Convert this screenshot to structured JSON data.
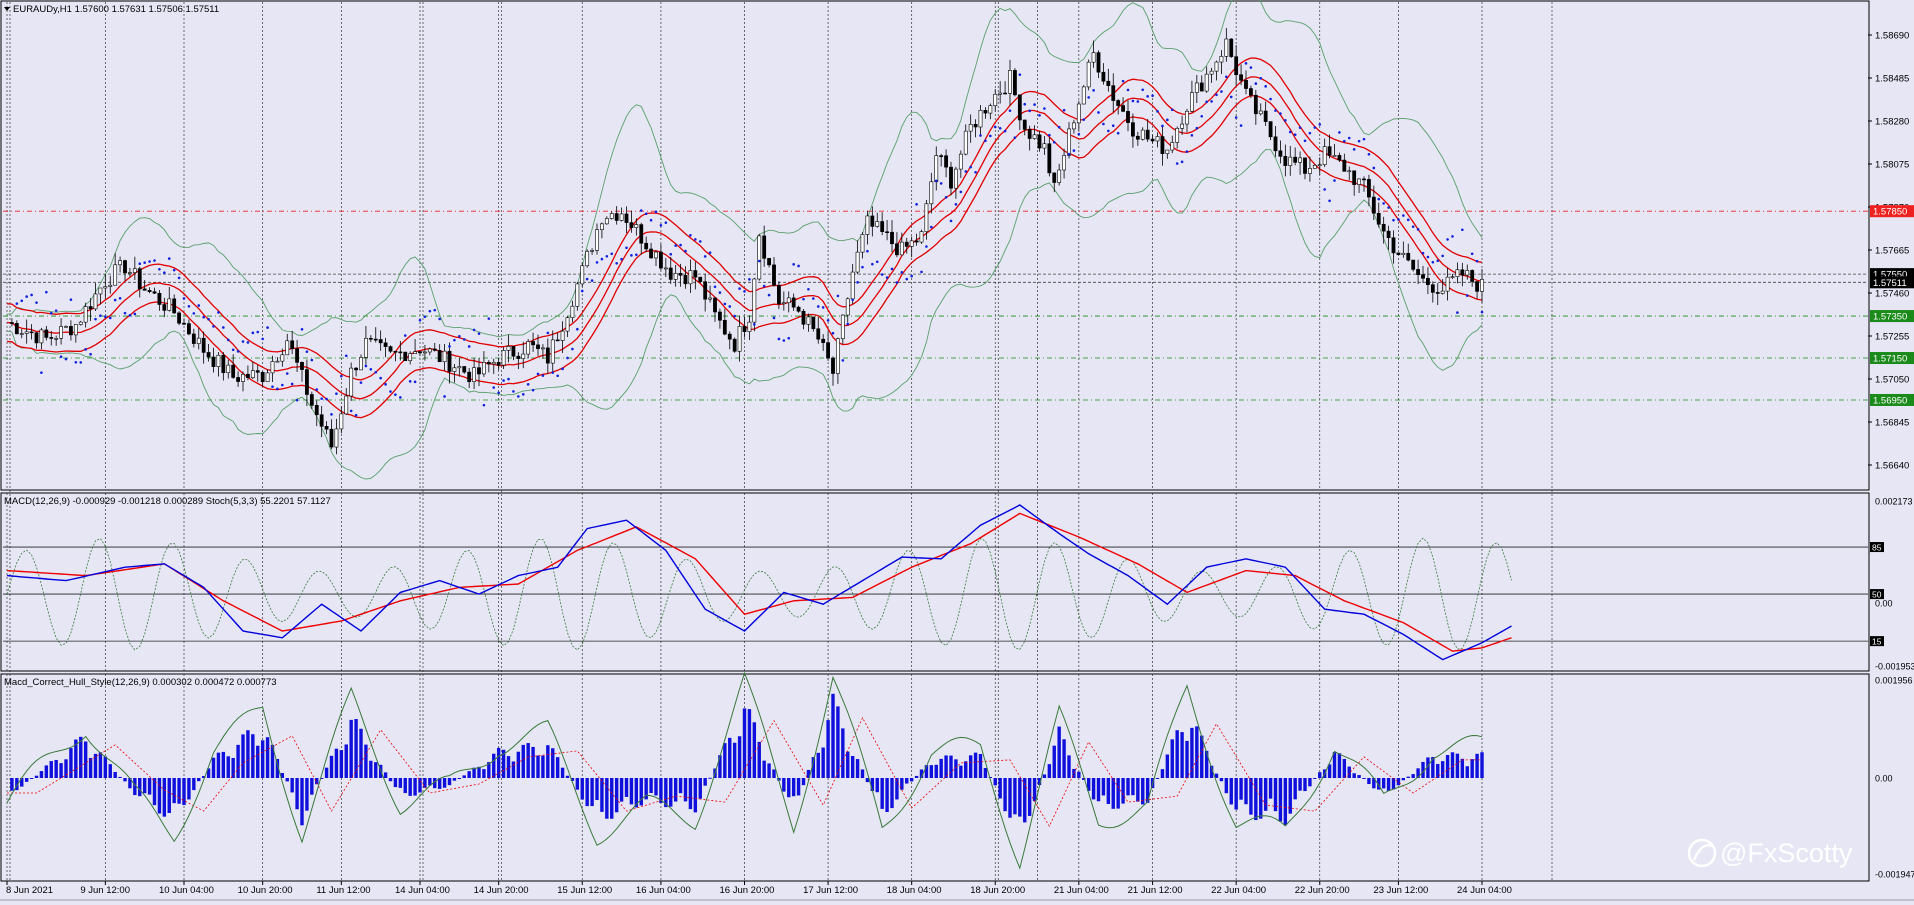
{
  "header": {
    "price_panel_title": "EURAUDy,H1  1.57600 1.57631 1.57506 1.57511",
    "macd_panel_title": "MACD(12,26,9) -0.000929 -0.001218 0.000289  Stoch(5,3,3) 55.2201 57.1127",
    "hull_panel_title": "Macd_Correct_Hull_Style(12,26,9) 0.000302 0.000472 0.000773"
  },
  "watermark": "@FxScotty",
  "colors": {
    "background": "#e6e6f5",
    "candle": "#000000",
    "bollinger": "#5aa06a",
    "envelope": "#e00000",
    "sar": "#1020e0",
    "macd_main": "#0000dd",
    "macd_signal": "#ee0000",
    "stoch": "#3a7a3a",
    "histogram": "#1010dd",
    "resistance_tag": "#ee2020",
    "support_tag": "#1a8a1a",
    "price_tag": "#000000"
  },
  "chart_data": [
    {
      "type": "candlestick",
      "symbol": "EURAUDy",
      "timeframe": "H1",
      "ylim": [
        1.5655,
        1.5875
      ],
      "y_ticks": [
        "1.58690",
        "1.58485",
        "1.58280",
        "1.58075",
        "1.57870",
        "1.57665",
        "1.57460",
        "1.57255",
        "1.57050",
        "1.56845",
        "1.56640"
      ],
      "y_tick_values": [
        1.5869,
        1.58485,
        1.5828,
        1.58075,
        1.5787,
        1.57665,
        1.5746,
        1.57255,
        1.5705,
        1.56845,
        1.5664
      ],
      "horizontal_lines": [
        {
          "label": "1.57850",
          "value": 1.5785,
          "style": "resistance"
        },
        {
          "label": "1.57550",
          "value": 1.5755,
          "style": "current"
        },
        {
          "label": "1.57511",
          "value": 1.57511,
          "style": "current"
        },
        {
          "label": "1.57350",
          "value": 1.5735,
          "style": "support"
        },
        {
          "label": "1.57150",
          "value": 1.5715,
          "style": "support"
        },
        {
          "label": "1.56950",
          "value": 1.5695,
          "style": "support"
        }
      ],
      "path_points": [
        [
          0,
          1.5732
        ],
        [
          8,
          1.5724
        ],
        [
          14,
          1.5731
        ],
        [
          20,
          1.5752
        ],
        [
          24,
          1.5759
        ],
        [
          28,
          1.5748
        ],
        [
          34,
          1.5737
        ],
        [
          40,
          1.5719
        ],
        [
          46,
          1.5706
        ],
        [
          52,
          1.5707
        ],
        [
          57,
          1.5724
        ],
        [
          62,
          1.5693
        ],
        [
          66,
          1.5673
        ],
        [
          70,
          1.5708
        ],
        [
          73,
          1.5722
        ],
        [
          78,
          1.5716
        ],
        [
          84,
          1.572
        ],
        [
          90,
          1.5713
        ],
        [
          95,
          1.5706
        ],
        [
          100,
          1.5715
        ],
        [
          106,
          1.5721
        ],
        [
          110,
          1.5715
        ],
        [
          113,
          1.5732
        ],
        [
          117,
          1.5756
        ],
        [
          121,
          1.5783
        ],
        [
          125,
          1.5785
        ],
        [
          130,
          1.577
        ],
        [
          135,
          1.5756
        ],
        [
          140,
          1.5754
        ],
        [
          144,
          1.5735
        ],
        [
          148,
          1.5722
        ],
        [
          151,
          1.5736
        ],
        [
          153,
          1.5775
        ],
        [
          157,
          1.5742
        ],
        [
          161,
          1.5738
        ],
        [
          165,
          1.5724
        ],
        [
          168,
          1.5708
        ],
        [
          172,
          1.5756
        ],
        [
          175,
          1.5779
        ],
        [
          178,
          1.5774
        ],
        [
          182,
          1.5766
        ],
        [
          186,
          1.5773
        ],
        [
          189,
          1.5812
        ],
        [
          192,
          1.58
        ],
        [
          196,
          1.5825
        ],
        [
          200,
          1.5838
        ],
        [
          204,
          1.5848
        ],
        [
          207,
          1.5825
        ],
        [
          211,
          1.5815
        ],
        [
          213,
          1.5795
        ],
        [
          217,
          1.583
        ],
        [
          221,
          1.586
        ],
        [
          225,
          1.584
        ],
        [
          229,
          1.5825
        ],
        [
          233,
          1.5818
        ],
        [
          236,
          1.5815
        ],
        [
          240,
          1.5836
        ],
        [
          244,
          1.585
        ],
        [
          248,
          1.5865
        ],
        [
          252,
          1.584
        ],
        [
          256,
          1.5825
        ],
        [
          260,
          1.581
        ],
        [
          264,
          1.5805
        ],
        [
          268,
          1.5812
        ],
        [
          272,
          1.5806
        ],
        [
          276,
          1.5796
        ],
        [
          280,
          1.5775
        ],
        [
          284,
          1.5762
        ],
        [
          288,
          1.5752
        ],
        [
          292,
          1.5748
        ],
        [
          296,
          1.5755
        ],
        [
          300,
          1.5749
        ]
      ],
      "candle_count": 300,
      "x_labels": [
        {
          "label": "8 Jun 2021",
          "bar": 0
        },
        {
          "label": "9 Jun 12:00",
          "bar": 20
        },
        {
          "label": "10 Jun 04:00",
          "bar": 36
        },
        {
          "label": "10 Jun 20:00",
          "bar": 52
        },
        {
          "label": "11 Jun 12:00",
          "bar": 68
        },
        {
          "label": "14 Jun 04:00",
          "bar": 84
        },
        {
          "label": "14 Jun 20:00",
          "bar": 100
        },
        {
          "label": "15 Jun 12:00",
          "bar": 117
        },
        {
          "label": "16 Jun 04:00",
          "bar": 133
        },
        {
          "label": "16 Jun 20:00",
          "bar": 150
        },
        {
          "label": "17 Jun 12:00",
          "bar": 167
        },
        {
          "label": "18 Jun 04:00",
          "bar": 184
        },
        {
          "label": "18 Jun 20:00",
          "bar": 201
        },
        {
          "label": "21 Jun 04:00",
          "bar": 218
        },
        {
          "label": "21 Jun 12:00",
          "bar": 233
        },
        {
          "label": "22 Jun 04:00",
          "bar": 250
        },
        {
          "label": "22 Jun 20:00",
          "bar": 267
        },
        {
          "label": "23 Jun 12:00",
          "bar": 283
        },
        {
          "label": "24 Jun 04:00",
          "bar": 300
        }
      ],
      "indicators": [
        "Bollinger Bands",
        "Envelope",
        "Parabolic SAR"
      ]
    },
    {
      "type": "line",
      "name": "MACD(12,26,9)  Stoch(5,3,3)",
      "ylim": [
        -0.00195,
        0.00217
      ],
      "y_ticks": [
        "0.002173",
        "85",
        "50",
        "0.00",
        "15",
        "-0.001953"
      ],
      "stoch_levels": [
        85,
        50,
        15
      ],
      "macd_points": [
        [
          0,
          0.55
        ],
        [
          12,
          0.52
        ],
        [
          24,
          0.6
        ],
        [
          32,
          0.62
        ],
        [
          40,
          0.48
        ],
        [
          48,
          0.22
        ],
        [
          56,
          0.18
        ],
        [
          64,
          0.38
        ],
        [
          72,
          0.22
        ],
        [
          80,
          0.45
        ],
        [
          88,
          0.52
        ],
        [
          96,
          0.44
        ],
        [
          104,
          0.55
        ],
        [
          112,
          0.6
        ],
        [
          118,
          0.83
        ],
        [
          126,
          0.88
        ],
        [
          134,
          0.7
        ],
        [
          142,
          0.35
        ],
        [
          150,
          0.22
        ],
        [
          158,
          0.45
        ],
        [
          166,
          0.38
        ],
        [
          174,
          0.52
        ],
        [
          182,
          0.66
        ],
        [
          190,
          0.65
        ],
        [
          198,
          0.85
        ],
        [
          206,
          0.97
        ],
        [
          214,
          0.8
        ],
        [
          220,
          0.68
        ],
        [
          228,
          0.55
        ],
        [
          236,
          0.38
        ],
        [
          244,
          0.6
        ],
        [
          252,
          0.65
        ],
        [
          260,
          0.6
        ],
        [
          268,
          0.35
        ],
        [
          276,
          0.32
        ],
        [
          284,
          0.2
        ],
        [
          292,
          0.05
        ],
        [
          300,
          0.15
        ],
        [
          306,
          0.25
        ]
      ],
      "signal_points": [
        [
          0,
          0.58
        ],
        [
          16,
          0.55
        ],
        [
          32,
          0.62
        ],
        [
          44,
          0.4
        ],
        [
          56,
          0.22
        ],
        [
          68,
          0.28
        ],
        [
          80,
          0.4
        ],
        [
          92,
          0.48
        ],
        [
          104,
          0.5
        ],
        [
          116,
          0.7
        ],
        [
          128,
          0.84
        ],
        [
          140,
          0.65
        ],
        [
          150,
          0.32
        ],
        [
          160,
          0.4
        ],
        [
          172,
          0.42
        ],
        [
          184,
          0.6
        ],
        [
          196,
          0.74
        ],
        [
          206,
          0.92
        ],
        [
          218,
          0.78
        ],
        [
          230,
          0.62
        ],
        [
          240,
          0.45
        ],
        [
          252,
          0.58
        ],
        [
          262,
          0.55
        ],
        [
          272,
          0.4
        ],
        [
          284,
          0.27
        ],
        [
          294,
          0.1
        ],
        [
          300,
          0.12
        ],
        [
          306,
          0.18
        ]
      ]
    },
    {
      "type": "bar",
      "name": "Macd_Correct_Hull_Style(12,26,9)",
      "ylim": [
        -0.00195,
        0.00196
      ],
      "y_ticks": [
        "0.001956",
        "0.00",
        "-0.001947"
      ],
      "histogram_segments": [
        [
          0,
          -0.25
        ],
        [
          8,
          0.15
        ],
        [
          16,
          0.55
        ],
        [
          26,
          -0.2
        ],
        [
          34,
          -0.55
        ],
        [
          42,
          0.25
        ],
        [
          52,
          0.7
        ],
        [
          60,
          -0.55
        ],
        [
          70,
          0.8
        ],
        [
          80,
          -0.25
        ],
        [
          90,
          -0.1
        ],
        [
          100,
          0.35
        ],
        [
          110,
          0.45
        ],
        [
          120,
          -0.55
        ],
        [
          130,
          -0.3
        ],
        [
          140,
          -0.4
        ],
        [
          150,
          0.95
        ],
        [
          160,
          -0.45
        ],
        [
          168,
          1.0
        ],
        [
          178,
          -0.5
        ],
        [
          188,
          0.25
        ],
        [
          198,
          0.3
        ],
        [
          206,
          -0.8
        ],
        [
          214,
          0.6
        ],
        [
          222,
          -0.4
        ],
        [
          232,
          -0.3
        ],
        [
          240,
          0.9
        ],
        [
          250,
          -0.45
        ],
        [
          260,
          -0.55
        ],
        [
          270,
          0.35
        ],
        [
          280,
          -0.25
        ],
        [
          290,
          0.3
        ],
        [
          300,
          0.3
        ]
      ]
    }
  ]
}
